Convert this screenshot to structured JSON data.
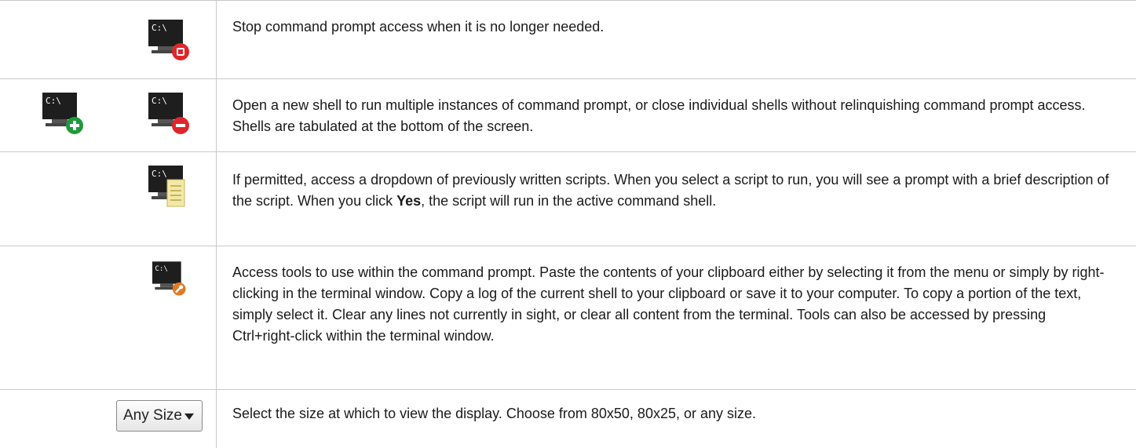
{
  "rows": [
    {
      "icons": [
        "stop-command-prompt-icon"
      ],
      "description": "Stop command prompt access when it is no longer needed."
    },
    {
      "icons": [
        "open-shell-icon",
        "close-shell-icon"
      ],
      "description": "Open a new shell to run multiple instances of command prompt, or close individual shells without relinquishing command prompt access. Shells are tabulated at the bottom of the screen."
    },
    {
      "icons": [
        "scripts-icon"
      ],
      "description_before": "If permitted, access a dropdown of previously written scripts. When you select a script to run, you will see a prompt with a brief description of the script. When you click ",
      "description_bold": "Yes",
      "description_after": ", the script will run in the active command shell."
    },
    {
      "icons": [
        "tools-icon"
      ],
      "description": "Access tools to use within the command prompt. Paste the contents of your clipboard either by selecting it from the menu or simply by right-clicking in the terminal window. Copy a log of the current shell to your clipboard or save it to your computer. To copy a portion of the text, simply select it. Clear any lines not currently in sight, or clear all content from the terminal. Tools can also be accessed by pressing Ctrl+right-click within the terminal window."
    },
    {
      "control": {
        "label": "Any Size",
        "icon": "chevron-down-icon"
      },
      "description": "Select the size at which to view the display. Choose from 80x50, 80x25, or any size."
    }
  ],
  "icon_text": "C:\\",
  "colors": {
    "border": "#c9c9c9",
    "stop": "#e0262b",
    "add": "#1e9a3a",
    "remove": "#e0262b",
    "script": "#f3e9a6",
    "tool": "#e07a25"
  }
}
